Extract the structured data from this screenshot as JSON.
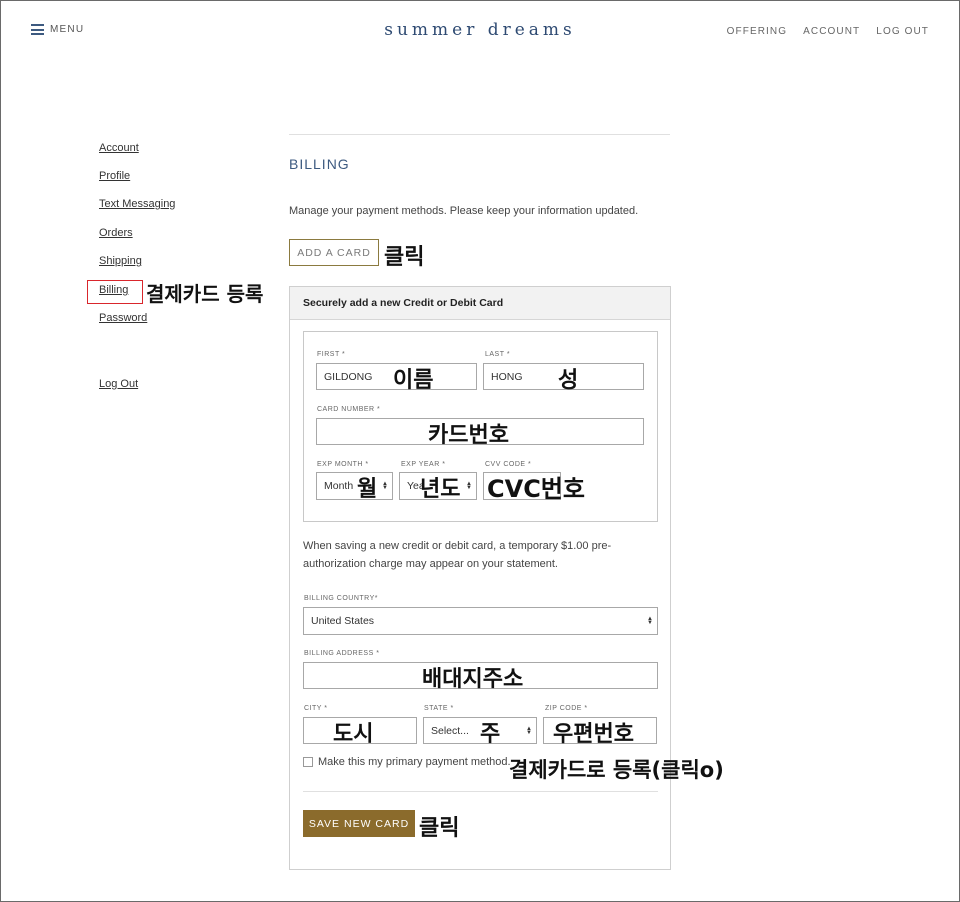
{
  "header": {
    "menu_label": "MENU",
    "brand": "summer dreams",
    "nav": [
      "OFFERING",
      "ACCOUNT",
      "LOG OUT"
    ]
  },
  "sidebar": {
    "items": [
      "Account",
      "Profile",
      "Text Messaging",
      "Orders",
      "Shipping",
      "Billing",
      "Password"
    ],
    "logout": "Log Out"
  },
  "main": {
    "title": "BILLING",
    "description": "Manage your payment methods. Please keep your information updated.",
    "add_card_label": "ADD A CARD",
    "panel_title": "Securely add a new Credit or Debit Card",
    "fields": {
      "first_label": "FIRST *",
      "first_value": "GILDONG",
      "last_label": "LAST *",
      "last_value": "HONG",
      "card_number_label": "CARD NUMBER *",
      "card_number_value": "",
      "exp_month_label": "EXP MONTH *",
      "exp_month_value": "Month",
      "exp_year_label": "EXP YEAR *",
      "exp_year_value": "Yea",
      "cvv_label": "CVV CODE *",
      "cvv_value": "",
      "billing_country_label": "BILLING COUNTRY*",
      "billing_country_value": "United States",
      "billing_address_label": "BILLING ADDRESS *",
      "billing_address_value": "",
      "city_label": "CITY *",
      "city_value": "",
      "state_label": "STATE *",
      "state_value": "Select...",
      "zip_label": "ZIP CODE *",
      "zip_value": ""
    },
    "note": "When saving a new credit or debit card, a temporary $1.00 pre-authorization charge may appear on your statement.",
    "primary_checkbox_label": "Make this my primary payment method.",
    "primary_checked": false,
    "save_label": "SAVE NEW CARD"
  },
  "annotations": {
    "click_add": "클릭",
    "billing_register": "결제카드 등록",
    "first_name": "이름",
    "last_name": "성",
    "card_number": "카드번호",
    "month": "월",
    "year": "년도",
    "cvc": "CVC번호",
    "address": "배대지주소",
    "city": "도시",
    "state": "주",
    "zip": "우편번호",
    "primary": "결제카드로 등록(클릭o)",
    "click_save": "클릭"
  },
  "colors": {
    "brand": "#2e4a72",
    "accent_button": "#8b6b2c",
    "add_button_border": "#8b7a3f",
    "highlight_box": "#d9262c"
  }
}
